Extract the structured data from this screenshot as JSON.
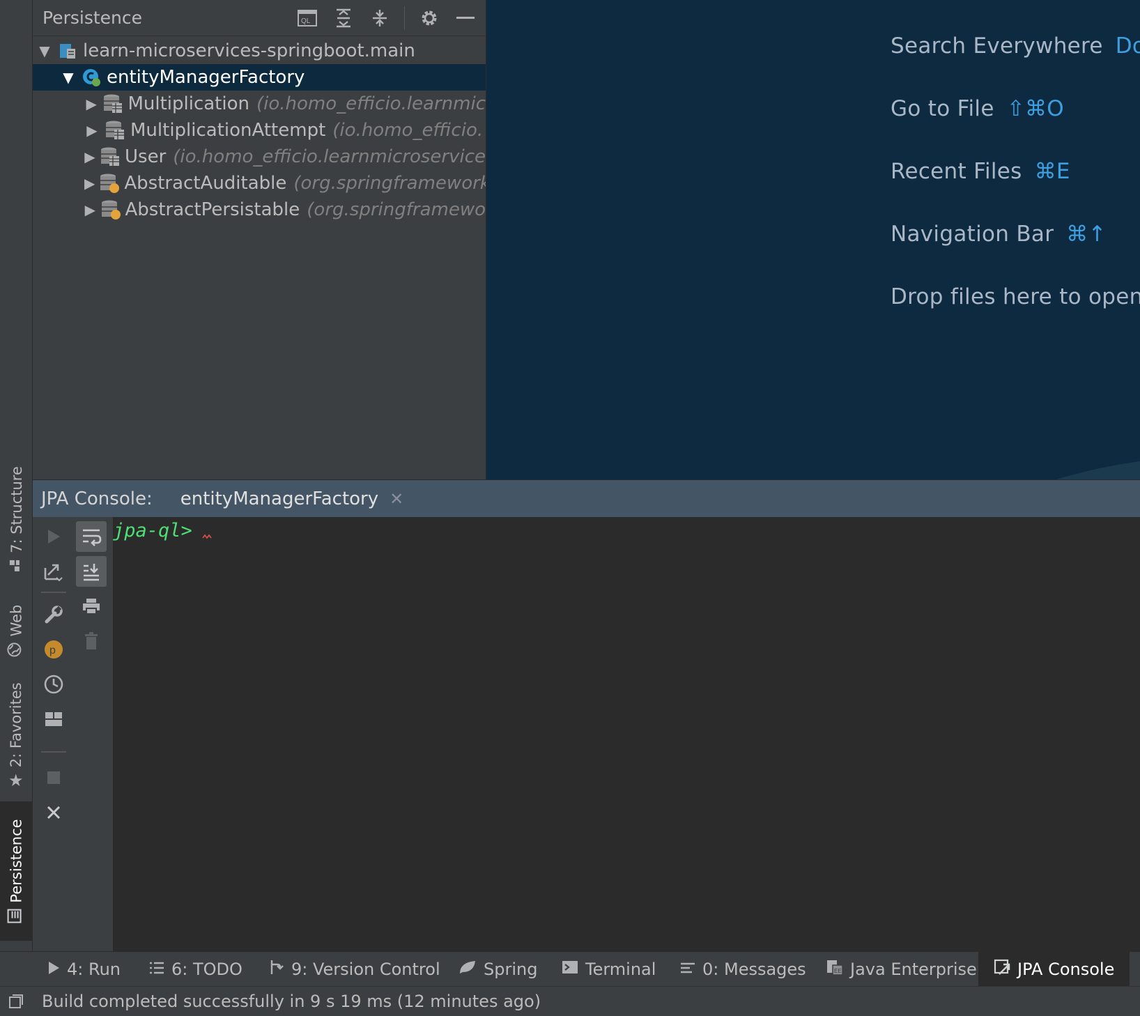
{
  "left_stripe": {
    "tabs": [
      {
        "label": "7: Structure",
        "icon": "structure-icon"
      },
      {
        "label": "Web",
        "icon": "globe-icon"
      },
      {
        "label": "2: Favorites",
        "icon": "star-icon"
      },
      {
        "label": "Persistence",
        "icon": "persistence-icon",
        "active": true
      }
    ]
  },
  "persistence": {
    "title": "Persistence",
    "tools": [
      "jpql-console-icon",
      "expand-all-icon",
      "collapse-all-icon",
      "gear-icon",
      "minimize-icon"
    ],
    "tree": {
      "module": "learn-microservices-springboot.main",
      "factory": "entityManagerFactory",
      "entities": [
        {
          "name": "Multiplication",
          "package": "(io.homo_efficio.learnmic"
        },
        {
          "name": "MultiplicationAttempt",
          "package": "(io.homo_efficio."
        },
        {
          "name": "User",
          "package": "(io.homo_efficio.learnmicroservice"
        },
        {
          "name": "AbstractAuditable",
          "package": "(org.springframework"
        },
        {
          "name": "AbstractPersistable",
          "package": "(org.springframewo"
        }
      ]
    }
  },
  "editor_hints": [
    {
      "label": "Search Everywhere",
      "key": "Dou"
    },
    {
      "label": "Go to File",
      "key": "⇧⌘O"
    },
    {
      "label": "Recent Files",
      "key": "⌘E"
    },
    {
      "label": "Navigation Bar",
      "key": "⌘↑"
    },
    {
      "label": "Drop files here to open",
      "key": ""
    }
  ],
  "console": {
    "label": "JPA Console:",
    "tab": "entityManagerFactory",
    "prompt": "jpa-ql>"
  },
  "bottom_tabs": [
    {
      "label": "4: Run",
      "icon": "run-icon"
    },
    {
      "label": "6: TODO",
      "icon": "todo-icon"
    },
    {
      "label": "9: Version Control",
      "icon": "vcs-icon"
    },
    {
      "label": "Spring",
      "icon": "spring-icon"
    },
    {
      "label": "Terminal",
      "icon": "terminal-icon"
    },
    {
      "label": "0: Messages",
      "icon": "messages-icon"
    },
    {
      "label": "Java Enterprise",
      "icon": "java-enterprise-icon"
    },
    {
      "label": "JPA Console",
      "icon": "jpa-console-icon",
      "active": true
    }
  ],
  "status": {
    "message": "Build completed successfully in 9 s 19 ms (12 minutes ago)"
  },
  "colors": {
    "accent_key": "#3d9fe0",
    "prompt_green": "#4ee076",
    "selection": "#0d293e",
    "editor_bg": "#0e2a40"
  }
}
